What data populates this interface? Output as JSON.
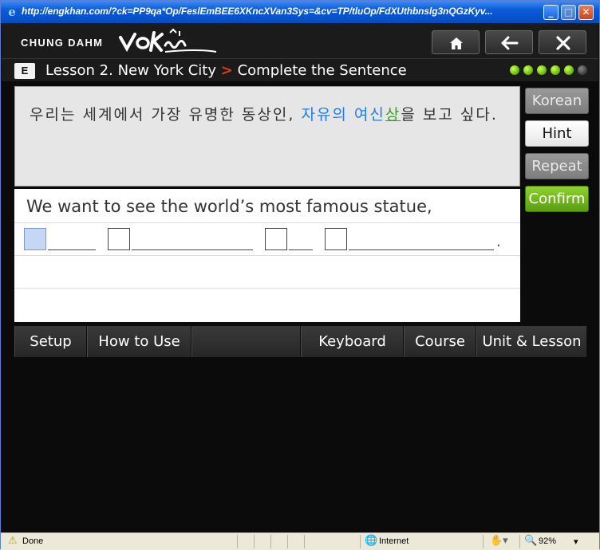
{
  "window": {
    "title": "http://engkhan.com/?ck=PP9qa*Op/FeslEmBEE6XKncXVan3Sys=&cv=TP/tluOp/FdXUthbnslg3nQGzKyv..."
  },
  "header": {
    "brand": "CHUNG DAHM",
    "logo_text": "VoKhan",
    "buttons": [
      "home",
      "back",
      "close"
    ]
  },
  "lesson_bar": {
    "level": "E",
    "lesson": "Lesson 2. New York City",
    "separator": ">",
    "activity": "Complete the Sentence",
    "progress": {
      "filled": 5,
      "total": 6
    }
  },
  "korean": {
    "before": "우리는 세계에서 가장 유명한 동상인, ",
    "highlight_blue": "자유의 여신",
    "highlight_green": "상",
    "after": "을 보고 싶다."
  },
  "english": {
    "sentence": "We want to see the world’s most famous statue,",
    "ending": "."
  },
  "side_buttons": {
    "korean": "Korean",
    "hint": "Hint",
    "repeat": "Repeat",
    "confirm": "Confirm"
  },
  "bottom_nav": [
    "Setup",
    "How to Use",
    "",
    "Keyboard",
    "Course",
    "Unit & Lesson"
  ],
  "statusbar": {
    "status": "Done",
    "zone": "Internet",
    "zoom": "92%"
  },
  "colors": {
    "titlebar": "#0a5bd9",
    "confirm": "#6cb41b",
    "korean_highlight": "#1f7ee0",
    "korean_highlight_green": "#3d9b2a",
    "separator": "#e53a1d"
  }
}
